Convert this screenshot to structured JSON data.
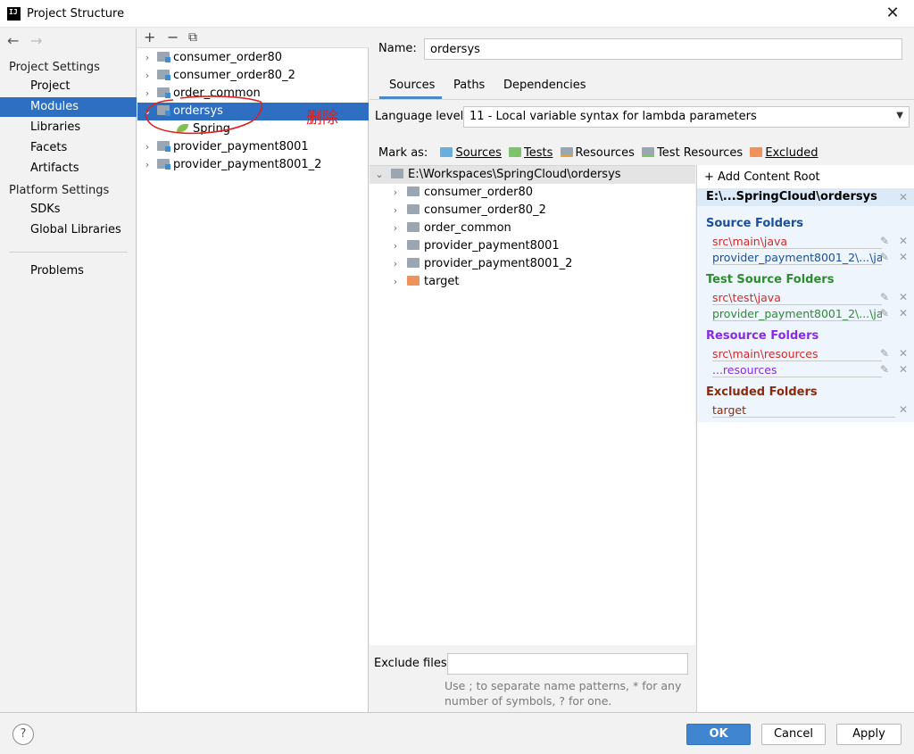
{
  "window": {
    "title": "Project Structure",
    "app_icon": "IJ"
  },
  "left": {
    "project_settings_head": "Project Settings",
    "project_settings": [
      "Project",
      "Modules",
      "Libraries",
      "Facets",
      "Artifacts"
    ],
    "platform_settings_head": "Platform Settings",
    "platform_settings": [
      "SDKs",
      "Global Libraries"
    ],
    "problems": "Problems"
  },
  "modules": {
    "toolbar": {
      "add": "+",
      "remove": "−",
      "copy": "⧉"
    },
    "items": [
      {
        "label": "consumer_order80"
      },
      {
        "label": "consumer_order80_2"
      },
      {
        "label": "order_common"
      },
      {
        "label": "ordersys",
        "selected": true
      },
      {
        "label": "Spring",
        "child": true
      },
      {
        "label": "provider_payment8001"
      },
      {
        "label": "provider_payment8001_2"
      }
    ]
  },
  "annotation": {
    "text": "删除",
    "color": "#e0201f"
  },
  "detail": {
    "name_label": "Name:",
    "name_value": "ordersys",
    "tabs": [
      "Sources",
      "Paths",
      "Dependencies"
    ],
    "language_label": "Language level:",
    "language_value": "11 - Local variable syntax for lambda parameters",
    "mark_as_label": "Mark as:",
    "mark_as": [
      {
        "label": "Sources",
        "color": "#6aaede"
      },
      {
        "label": "Tests",
        "color": "#7cc36b"
      },
      {
        "label": "Resources",
        "color": "#9aa6b2"
      },
      {
        "label": "Test Resources",
        "color": "#9aa6b2"
      },
      {
        "label": "Excluded",
        "color": "#f0935a"
      }
    ],
    "source_root": "E:\\Workspaces\\SpringCloud\\ordersys",
    "source_children": [
      "consumer_order80",
      "consumer_order80_2",
      "order_common",
      "provider_payment8001",
      "provider_payment8001_2",
      "target"
    ],
    "exclude_label": "Exclude files:",
    "exclude_value": "",
    "exclude_hint": "Use ; to separate name patterns, * for any number of symbols, ? for one."
  },
  "content_root": {
    "add_label": "Add Content Root",
    "path": "E:\\...SpringCloud\\ordersys",
    "groups": [
      {
        "title": "Source Folders",
        "color": "#1b4f9c",
        "items": [
          {
            "text": "src\\main\\java",
            "color": "#d22a2a"
          },
          {
            "text": "provider_payment8001_2\\...\\java",
            "color": "#1b4f9c"
          }
        ]
      },
      {
        "title": "Test Source Folders",
        "color": "#2e8b30",
        "items": [
          {
            "text": "src\\test\\java",
            "color": "#d22a2a"
          },
          {
            "text": "provider_payment8001_2\\...\\java",
            "color": "#2e8b30"
          }
        ]
      },
      {
        "title": "Resource Folders",
        "color": "#8a2be2",
        "items": [
          {
            "text": "src\\main\\resources",
            "color": "#d22a2a"
          },
          {
            "text": "...resources",
            "color": "#8a2be2"
          }
        ]
      },
      {
        "title": "Excluded Folders",
        "color": "#8b2a0d",
        "items": [
          {
            "text": "target",
            "color": "#8b2a0d"
          }
        ]
      }
    ]
  },
  "buttons": {
    "help": "?",
    "ok": "OK",
    "cancel": "Cancel",
    "apply": "Apply"
  }
}
